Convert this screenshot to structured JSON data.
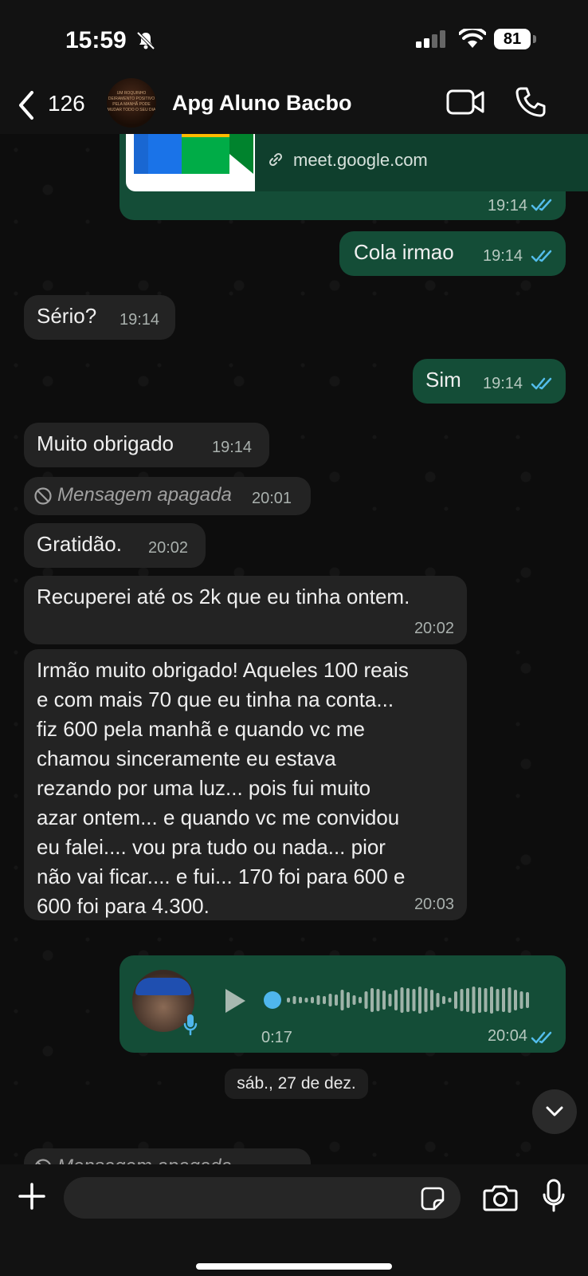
{
  "status_bar": {
    "time": "15:59",
    "battery": "81"
  },
  "header": {
    "back_count": "126",
    "title": "Apg Aluno Bacbo",
    "avatar_text": "UM ROQUINHO DEIRAMENTO POSITIVO PELA MANHÃ PODE MUDAR TODO O SEU DIA"
  },
  "messages": [
    {
      "type": "link-preview",
      "direction": "out",
      "link": "meet.google.com",
      "time": "19:14"
    },
    {
      "type": "text",
      "direction": "out",
      "text": "Cola irmao",
      "time": "19:14"
    },
    {
      "type": "text",
      "direction": "in",
      "text": "Sério?",
      "time": "19:14"
    },
    {
      "type": "text",
      "direction": "out",
      "text": "Sim",
      "time": "19:14"
    },
    {
      "type": "text",
      "direction": "in",
      "text": "Muito obrigado",
      "time": "19:14"
    },
    {
      "type": "deleted",
      "direction": "in",
      "text": "Mensagem apagada",
      "time": "20:01"
    },
    {
      "type": "text",
      "direction": "in",
      "text": "Gratidão.",
      "time": "20:02"
    },
    {
      "type": "text",
      "direction": "in",
      "text": "Recuperei até os 2k que eu tinha ontem.",
      "time": "20:02"
    },
    {
      "type": "text",
      "direction": "in",
      "lines": [
        "Irmão muito obrigado! Aqueles 100 reais",
        "e com mais 70 que eu tinha na conta...",
        "fiz 600 pela manhã e quando vc me",
        "chamou sinceramente eu estava",
        "rezando por uma luz... pois fui muito",
        "azar ontem... e quando vc me convidou",
        "eu falei.... vou pra tudo ou nada... pior",
        "não vai ficar.... e fui... 170 foi para 600 e",
        "600 foi para 4.300."
      ],
      "time": "20:03"
    },
    {
      "type": "voice",
      "direction": "out",
      "duration": "0:17",
      "time": "20:04"
    }
  ],
  "date_separator": "sáb., 27 de dez.",
  "partial_message": "Mensagem apagada",
  "colors": {
    "outgoing": "#144d37",
    "incoming": "#232323",
    "read_ticks": "#53bdeb",
    "voice_dot": "#4fb6ec"
  },
  "icons": [
    "bell-slash-icon",
    "signal-icon",
    "wifi-icon",
    "battery-icon",
    "back-chevron-icon",
    "video-call-icon",
    "phone-icon",
    "link-icon",
    "double-check-icon",
    "ban-icon",
    "play-icon",
    "mic-icon",
    "plus-icon",
    "sticker-icon",
    "camera-icon",
    "chevron-down-icon"
  ]
}
